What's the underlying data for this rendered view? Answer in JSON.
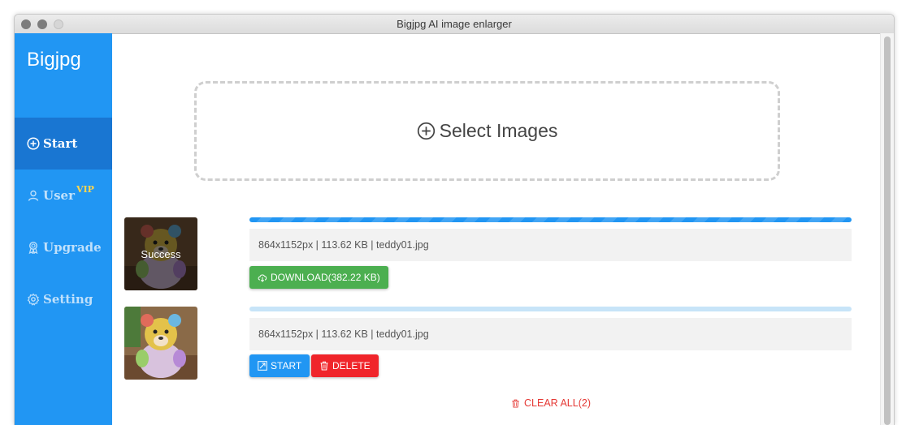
{
  "window": {
    "title": "Bigjpg AI image enlarger"
  },
  "sidebar": {
    "brand": "Bigjpg",
    "items": [
      {
        "label": "Start",
        "icon": "plus-circle-icon",
        "active": true
      },
      {
        "label": "User",
        "icon": "user-icon",
        "badge": "VIP"
      },
      {
        "label": "Upgrade",
        "icon": "award-icon"
      },
      {
        "label": "Setting",
        "icon": "gear-icon"
      }
    ]
  },
  "dropzone": {
    "label": "Select Images",
    "icon": "plus-circle-icon"
  },
  "tasks": [
    {
      "status": "Success",
      "progress": 1.0,
      "info": "864x1152px | 113.62 KB | teddy01.jpg",
      "buttons": [
        {
          "label": "DOWNLOAD(382.22 KB)",
          "icon": "cloud-download-icon"
        }
      ]
    },
    {
      "progress": 0.0,
      "info": "864x1152px | 113.62 KB | teddy01.jpg",
      "buttons": [
        {
          "label": "START",
          "icon": "expand-icon"
        },
        {
          "label": "DELETE",
          "icon": "trash-icon"
        }
      ]
    }
  ],
  "clear_all": {
    "label": "CLEAR ALL(2)",
    "icon": "trash-icon"
  },
  "colors": {
    "sidebar": "#2196f3",
    "sidebar_active": "#1976d2",
    "success": "#4caf50",
    "primary": "#2196f3",
    "danger": "#f0252b",
    "vip": "#ffd54f"
  }
}
